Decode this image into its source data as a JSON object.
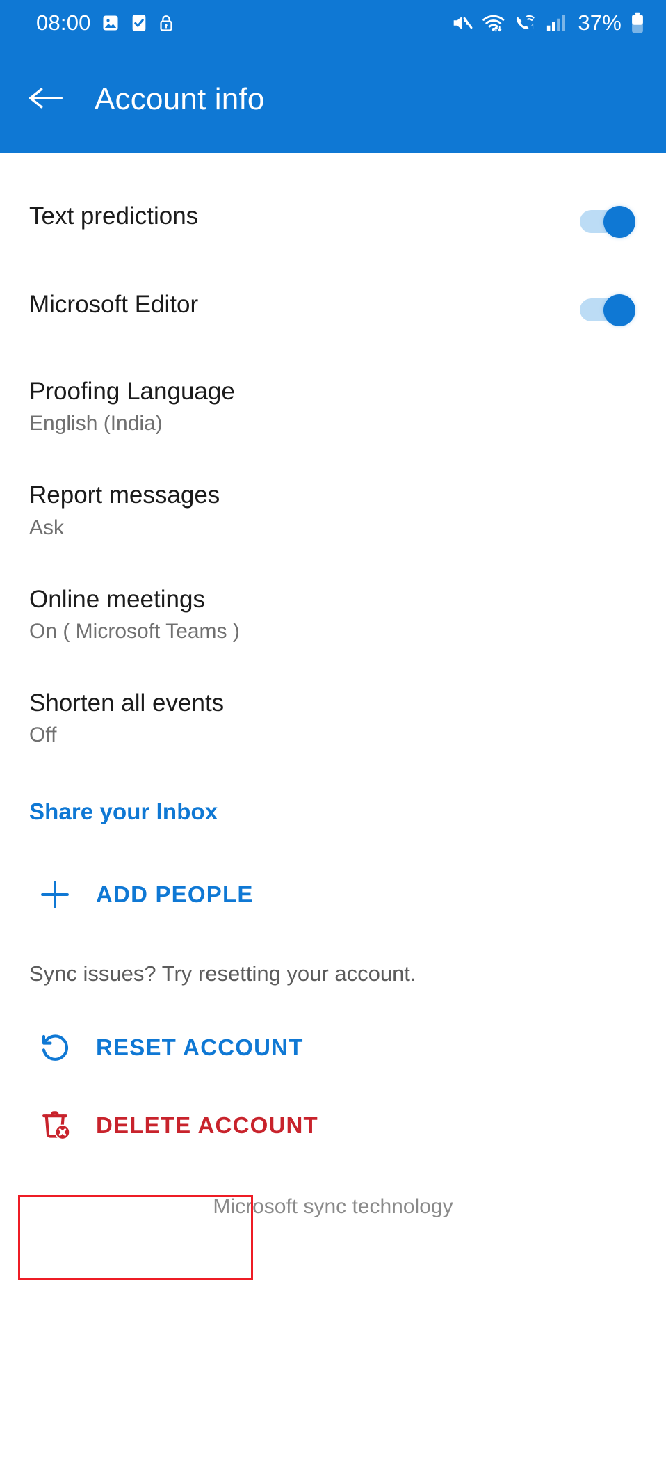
{
  "statusbar": {
    "time": "08:00",
    "battery_percent": "37%",
    "left_icons": [
      "image-icon",
      "task-checkbox-icon",
      "lock-icon"
    ],
    "right_icons": [
      "mute-icon",
      "wifi-icon",
      "vowifi-call-icon",
      "signal-bars-icon",
      "battery-icon"
    ]
  },
  "appbar": {
    "back_icon": "back-arrow-icon",
    "title": "Account info",
    "background_color": "#0f78d4"
  },
  "settings": [
    {
      "title": "Text predictions",
      "sub": "",
      "control": "toggle",
      "state": "on"
    },
    {
      "title": "Microsoft Editor",
      "sub": "",
      "control": "toggle",
      "state": "on"
    },
    {
      "title": "Proofing Language",
      "sub": "English (India)",
      "control": "none",
      "state": ""
    },
    {
      "title": "Report messages",
      "sub": "Ask",
      "control": "none",
      "state": ""
    },
    {
      "title": "Online meetings",
      "sub": "On ( Microsoft Teams )",
      "control": "none",
      "state": ""
    },
    {
      "title": "Shorten all events",
      "sub": "Off",
      "control": "none",
      "state": ""
    }
  ],
  "share": {
    "heading": "Share your Inbox",
    "add_people_label": "ADD PEOPLE",
    "add_people_icon": "plus-icon"
  },
  "account_actions": {
    "sync_hint": "Sync issues? Try resetting your account.",
    "reset_label": "RESET ACCOUNT",
    "reset_icon": "reset-circular-arrow-icon",
    "delete_label": "DELETE ACCOUNT",
    "delete_icon": "trash-delete-icon"
  },
  "footer": {
    "text": "Microsoft sync technology"
  },
  "colors": {
    "accent_blue": "#0f78d4",
    "danger_red": "#c8232c",
    "annotation_red": "#ee1c25",
    "toggle_track": "#bcdcf5",
    "subtitle_gray": "#707070"
  },
  "annotation": {
    "target": "reset-account-row"
  }
}
